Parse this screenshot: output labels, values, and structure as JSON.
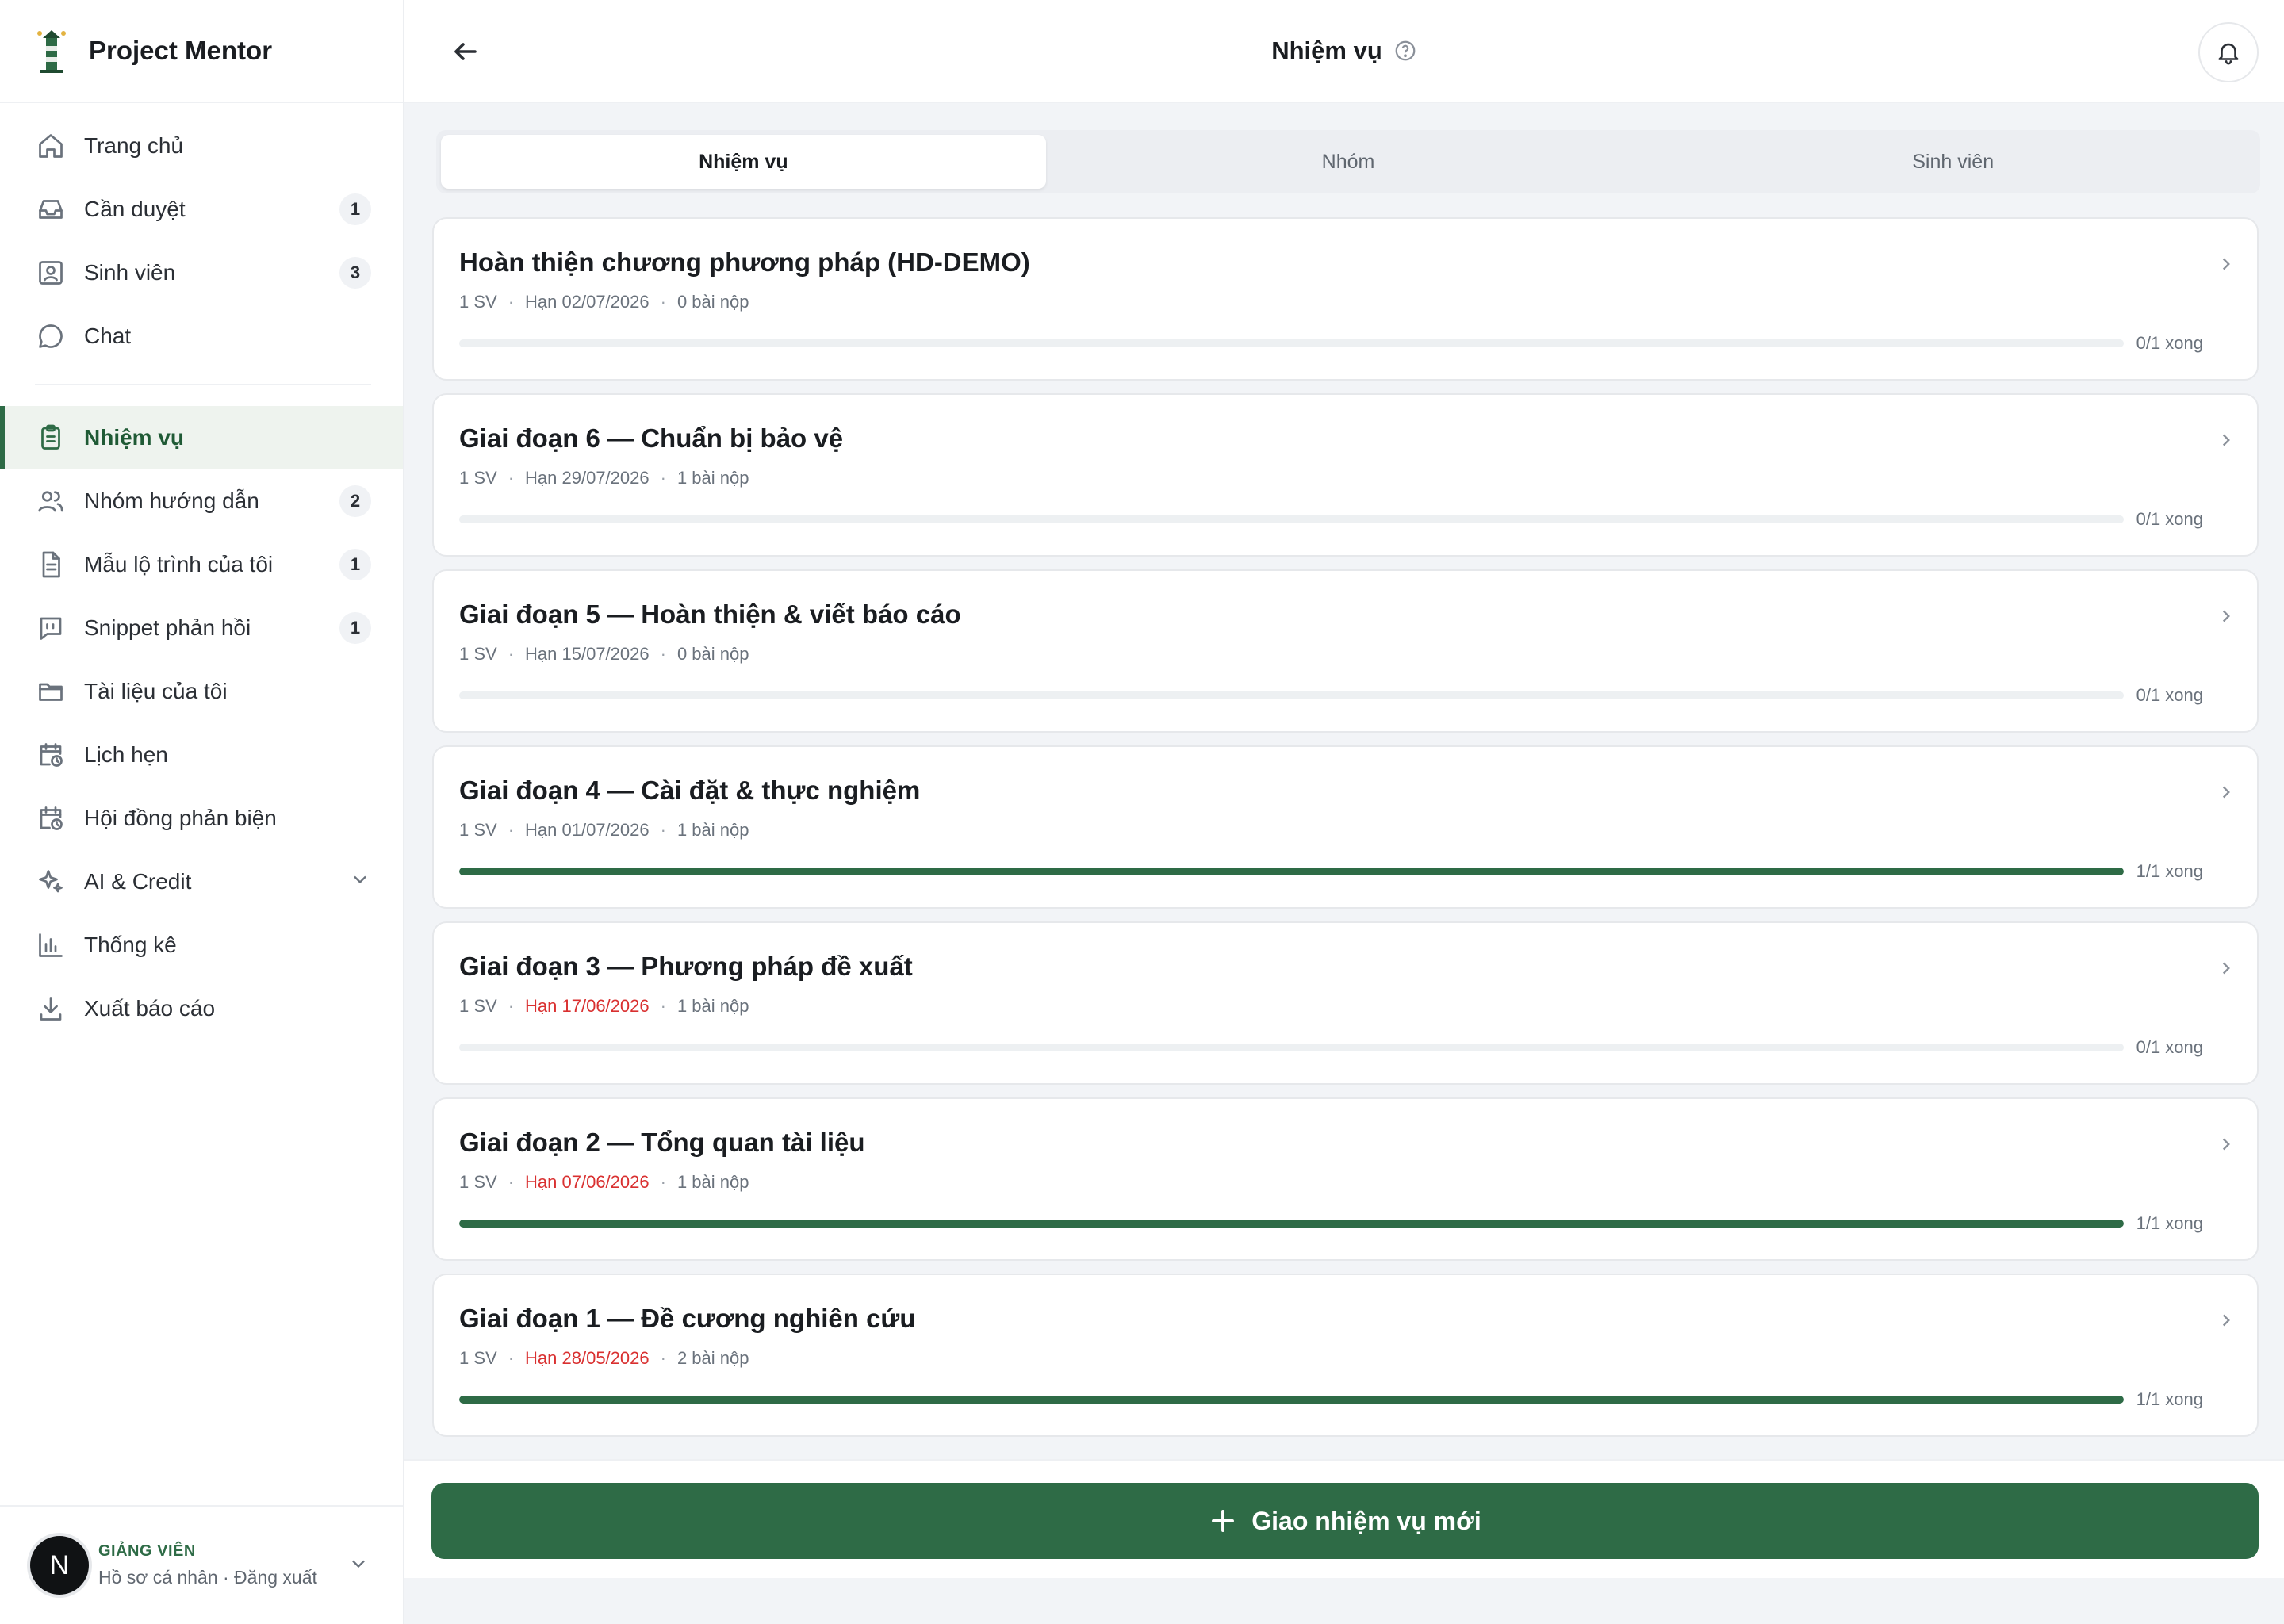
{
  "brand": {
    "name": "Project Mentor"
  },
  "sidebar": {
    "items": [
      {
        "label": "Trang chủ",
        "icon": "home-icon",
        "badge": ""
      },
      {
        "label": "Cần duyệt",
        "icon": "inbox-icon",
        "badge": "1"
      },
      {
        "label": "Sinh viên",
        "icon": "user-card-icon",
        "badge": "3"
      },
      {
        "label": "Chat",
        "icon": "chat-icon",
        "badge": ""
      },
      {
        "label": "Nhiệm vụ",
        "icon": "clipboard-icon",
        "badge": "",
        "active": true
      },
      {
        "label": "Nhóm hướng dẫn",
        "icon": "users-icon",
        "badge": "2"
      },
      {
        "label": "Mẫu lộ trình của tôi",
        "icon": "document-icon",
        "badge": "1"
      },
      {
        "label": "Snippet phản hồi",
        "icon": "quote-icon",
        "badge": "1"
      },
      {
        "label": "Tài liệu của tôi",
        "icon": "folder-icon",
        "badge": ""
      },
      {
        "label": "Lịch hẹn",
        "icon": "calendar-clock-icon",
        "badge": ""
      },
      {
        "label": "Hội đồng phản biện",
        "icon": "calendar-clock-icon",
        "badge": ""
      },
      {
        "label": "AI & Credit",
        "icon": "sparkles-icon",
        "badge": ""
      },
      {
        "label": "Thống kê",
        "icon": "bar-chart-icon",
        "badge": ""
      },
      {
        "label": "Xuất báo cáo",
        "icon": "download-icon",
        "badge": ""
      }
    ]
  },
  "user": {
    "initial": "N",
    "role": "GIẢNG VIÊN",
    "links": "Hồ sơ cá nhân · Đăng xuất"
  },
  "header": {
    "title": "Nhiệm vụ"
  },
  "tabs": [
    {
      "label": "Nhiệm vụ",
      "active": true
    },
    {
      "label": "Nhóm",
      "active": false
    },
    {
      "label": "Sinh viên",
      "active": false
    }
  ],
  "tasks": [
    {
      "title": "Hoàn thiện chương phương pháp (HD-DEMO)",
      "students": "1 SV",
      "due": "Hạn 02/07/2026",
      "overdue": false,
      "submissions": "0 bài nộp",
      "progress": 0,
      "progress_label": "0/1 xong"
    },
    {
      "title": "Giai đoạn 6 — Chuẩn bị bảo vệ",
      "students": "1 SV",
      "due": "Hạn 29/07/2026",
      "overdue": false,
      "submissions": "1 bài nộp",
      "progress": 0,
      "progress_label": "0/1 xong"
    },
    {
      "title": "Giai đoạn 5 — Hoàn thiện & viết báo cáo",
      "students": "1 SV",
      "due": "Hạn 15/07/2026",
      "overdue": false,
      "submissions": "0 bài nộp",
      "progress": 0,
      "progress_label": "0/1 xong"
    },
    {
      "title": "Giai đoạn 4 — Cài đặt & thực nghiệm",
      "students": "1 SV",
      "due": "Hạn 01/07/2026",
      "overdue": false,
      "submissions": "1 bài nộp",
      "progress": 1,
      "progress_label": "1/1 xong"
    },
    {
      "title": "Giai đoạn 3 — Phương pháp đề xuất",
      "students": "1 SV",
      "due": "Hạn 17/06/2026",
      "overdue": true,
      "submissions": "1 bài nộp",
      "progress": 0,
      "progress_label": "0/1 xong"
    },
    {
      "title": "Giai đoạn 2 — Tổng quan tài liệu",
      "students": "1 SV",
      "due": "Hạn 07/06/2026",
      "overdue": true,
      "submissions": "1 bài nộp",
      "progress": 1,
      "progress_label": "1/1 xong"
    },
    {
      "title": "Giai đoạn 1 — Đề cương nghiên cứu",
      "students": "1 SV",
      "due": "Hạn 28/05/2026",
      "overdue": true,
      "submissions": "2 bài nộp",
      "progress": 1,
      "progress_label": "1/1 xong"
    }
  ],
  "actions": {
    "assign_label": "Giao nhiệm vụ mới"
  },
  "colors": {
    "accent": "#2e6b46",
    "overdue": "#d93030",
    "track": "#edf0f2"
  }
}
